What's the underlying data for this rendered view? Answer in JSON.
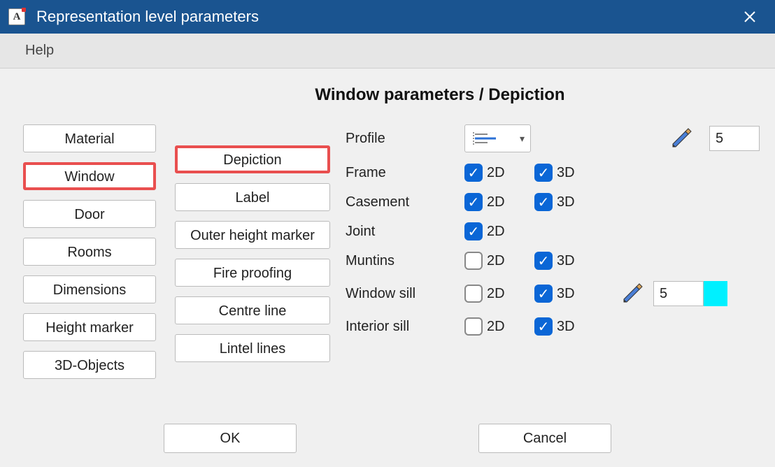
{
  "window": {
    "app_icon_letter": "A",
    "title": "Representation level parameters"
  },
  "menu": {
    "help": "Help"
  },
  "page_title": "Window parameters / Depiction",
  "categories": [
    {
      "label": "Material",
      "highlight": false
    },
    {
      "label": "Window",
      "highlight": true
    },
    {
      "label": "Door",
      "highlight": false
    },
    {
      "label": "Rooms",
      "highlight": false
    },
    {
      "label": "Dimensions",
      "highlight": false
    },
    {
      "label": "Height marker",
      "highlight": false
    },
    {
      "label": "3D-Objects",
      "highlight": false
    }
  ],
  "subtabs": [
    {
      "label": "Depiction",
      "highlight": true
    },
    {
      "label": "Label",
      "highlight": false
    },
    {
      "label": "Outer height marker",
      "highlight": false
    },
    {
      "label": "Fire proofing",
      "highlight": false
    },
    {
      "label": "Centre line",
      "highlight": false
    },
    {
      "label": "Lintel lines",
      "highlight": false
    }
  ],
  "params": {
    "profile": {
      "label": "Profile",
      "pen_value": "5",
      "swatch": "#00f0ff"
    },
    "frame": {
      "label": "Frame",
      "d2": true,
      "d3": true
    },
    "casement": {
      "label": "Casement",
      "d2": true,
      "d3": true
    },
    "joint": {
      "label": "Joint",
      "d2": true
    },
    "muntins": {
      "label": "Muntins",
      "d2": false,
      "d3": true
    },
    "windowsill": {
      "label": "Window sill",
      "d2": false,
      "d3": true,
      "pen_value": "5",
      "swatch": "#00f0ff"
    },
    "interiorsill": {
      "label": "Interior sill",
      "d2": false,
      "d3": true
    }
  },
  "labels": {
    "d2": "2D",
    "d3": "3D"
  },
  "footer": {
    "ok": "OK",
    "cancel": "Cancel"
  }
}
